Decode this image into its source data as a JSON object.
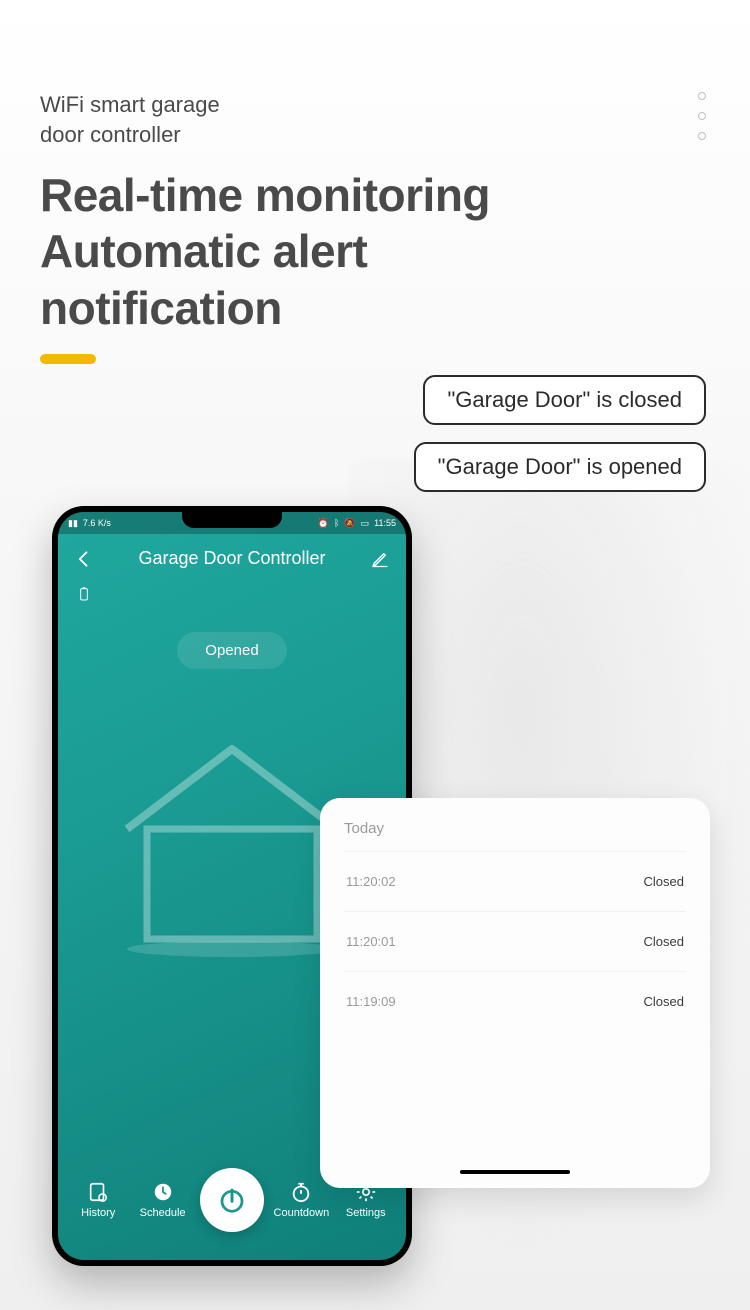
{
  "header": {
    "product_label": "WiFi smart garage\ndoor controller",
    "headline": "Real-time monitoring\nAutomatic alert\nnotification"
  },
  "bubbles": {
    "closed": "\"Garage Door\" is closed",
    "opened": "\"Garage Door\" is opened"
  },
  "phone": {
    "status_bar": {
      "speed": "7.6 K/s",
      "time": "11:55"
    },
    "app_title": "Garage Door Controller",
    "door_status": "Opened",
    "nav": {
      "history": "History",
      "schedule": "Schedule",
      "countdown": "Countdown",
      "settings": "Settings"
    }
  },
  "log": {
    "header": "Today",
    "entries": [
      {
        "time": "11:20:02",
        "state": "Closed"
      },
      {
        "time": "11:20:01",
        "state": "Closed"
      },
      {
        "time": "11:19:09",
        "state": "Closed"
      }
    ]
  }
}
